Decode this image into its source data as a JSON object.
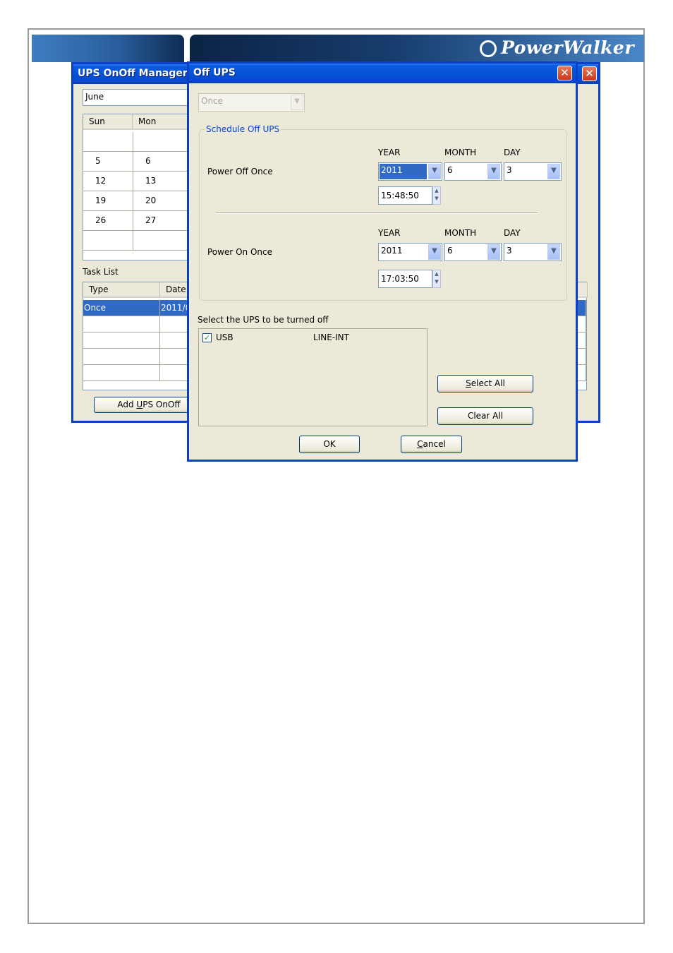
{
  "brand": {
    "name": "PowerWalker"
  },
  "manager_window": {
    "title": "UPS OnOff Manager",
    "month_value": "June",
    "calendar": {
      "headers": [
        "Sun",
        "Mon"
      ],
      "rows": [
        [
          "",
          ""
        ],
        [
          "5",
          "6"
        ],
        [
          "12",
          "13"
        ],
        [
          "19",
          "20"
        ],
        [
          "26",
          "27"
        ],
        [
          "",
          ""
        ]
      ]
    },
    "task_list_label": "Task List",
    "task_table": {
      "headers": [
        "Type",
        "Date"
      ],
      "rows": [
        [
          "Once",
          "2011/0"
        ],
        [
          "",
          ""
        ],
        [
          "",
          ""
        ],
        [
          "",
          ""
        ],
        [
          "",
          ""
        ]
      ]
    },
    "add_button": {
      "pre": "Add ",
      "mnemonic": "U",
      "post": "PS OnOff"
    }
  },
  "off_ups_dialog": {
    "title": "Off UPS",
    "mode_value": "Once",
    "schedule_group_title": "Schedule Off UPS",
    "col_labels": {
      "year": "YEAR",
      "month": "MONTH",
      "day": "DAY"
    },
    "power_off": {
      "label": "Power Off Once",
      "year": "2011",
      "month": "6",
      "day": "3",
      "time": "15:48:50"
    },
    "power_on": {
      "label": "Power On Once",
      "year": "2011",
      "month": "6",
      "day": "3",
      "time": "17:03:50"
    },
    "select_label": "Select the UPS to be turned off",
    "ups_list": [
      {
        "checked": true,
        "name": "USB",
        "type": "LINE-INT"
      }
    ],
    "select_all": {
      "mnemonic": "S",
      "post": "elect All"
    },
    "clear_all": "Clear All",
    "ok": "OK",
    "cancel": {
      "mnemonic": "C",
      "post": "ancel"
    }
  },
  "colors": {
    "titlebar": "#0553d7",
    "selection": "#316ac5",
    "dialog_bg": "#ece9d8",
    "group_title": "#0046d5"
  }
}
